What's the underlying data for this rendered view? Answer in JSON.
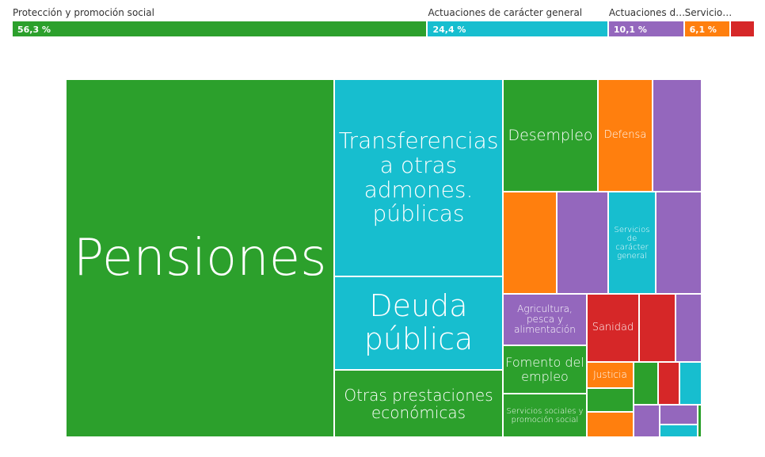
{
  "colors": {
    "proteccion": "#2ca02c",
    "actuaciones_general": "#17becf",
    "actuaciones_economico": "#9467bd",
    "servicios_publicos": "#ff7f0e",
    "otros": "#d62728"
  },
  "chart_data": {
    "type": "treemap",
    "groups": [
      {
        "key": "proteccion",
        "label": "Protección y promoción social",
        "share_label": "56,3 %",
        "share": 56.3
      },
      {
        "key": "actuaciones_general",
        "label": "Actuaciones de carácter general",
        "share_label": "24,4 %",
        "share": 24.4
      },
      {
        "key": "actuaciones_economico",
        "label": "Actuaciones de ...",
        "share_label": "10,1 %",
        "share": 10.1
      },
      {
        "key": "servicios_publicos",
        "label": "Servicios...",
        "share_label": "6,1 %",
        "share": 6.1
      },
      {
        "key": "otros",
        "label": "",
        "share_label": "",
        "share": 3.1
      }
    ],
    "leaves": [
      {
        "label": "Pensiones",
        "group": "proteccion"
      },
      {
        "label": "Transferencias a otras admones. públicas",
        "group": "actuaciones_general"
      },
      {
        "label": "Deuda pública",
        "group": "actuaciones_general"
      },
      {
        "label": "Otras prestaciones económicas",
        "group": "proteccion"
      },
      {
        "label": "Desempleo",
        "group": "proteccion"
      },
      {
        "label": "Defensa",
        "group": "servicios_publicos"
      },
      {
        "label": "",
        "group": "actuaciones_economico"
      },
      {
        "label": "",
        "group": "servicios_publicos"
      },
      {
        "label": "",
        "group": "actuaciones_economico"
      },
      {
        "label": "Servicios de carácter general",
        "group": "actuaciones_general"
      },
      {
        "label": "",
        "group": "actuaciones_economico"
      },
      {
        "label": "Agricultura, pesca y alimentación",
        "group": "actuaciones_economico"
      },
      {
        "label": "Sanidad",
        "group": "otros"
      },
      {
        "label": "",
        "group": "otros"
      },
      {
        "label": "",
        "group": "actuaciones_economico"
      },
      {
        "label": "Fomento del empleo",
        "group": "proteccion"
      },
      {
        "label": "Justicia",
        "group": "servicios_publicos"
      },
      {
        "label": "",
        "group": "proteccion"
      },
      {
        "label": "",
        "group": "otros"
      },
      {
        "label": "",
        "group": "actuaciones_general"
      },
      {
        "label": "Servicios sociales y promoción social",
        "group": "proteccion"
      },
      {
        "label": "",
        "group": "proteccion"
      },
      {
        "label": "",
        "group": "servicios_publicos"
      },
      {
        "label": "",
        "group": "actuaciones_economico"
      },
      {
        "label": "",
        "group": "actuaciones_economico"
      },
      {
        "label": "",
        "group": "proteccion"
      },
      {
        "label": "",
        "group": "actuaciones_general"
      }
    ]
  }
}
